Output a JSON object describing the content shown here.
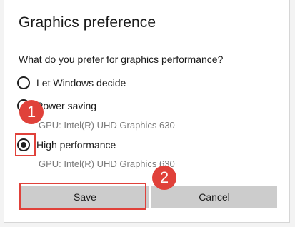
{
  "dialog": {
    "title": "Graphics preference",
    "question": "What do you prefer for graphics performance?",
    "options": [
      {
        "label": "Let Windows decide",
        "selected": false,
        "gpu": ""
      },
      {
        "label": "Power saving",
        "selected": false,
        "gpu": "GPU: Intel(R) UHD Graphics 630"
      },
      {
        "label": "High performance",
        "selected": true,
        "gpu": "GPU: Intel(R) UHD Graphics 630"
      }
    ],
    "buttons": {
      "save": "Save",
      "cancel": "Cancel"
    }
  },
  "annotations": {
    "badge_1": "1",
    "badge_2": "2",
    "color": "#e0413a"
  }
}
